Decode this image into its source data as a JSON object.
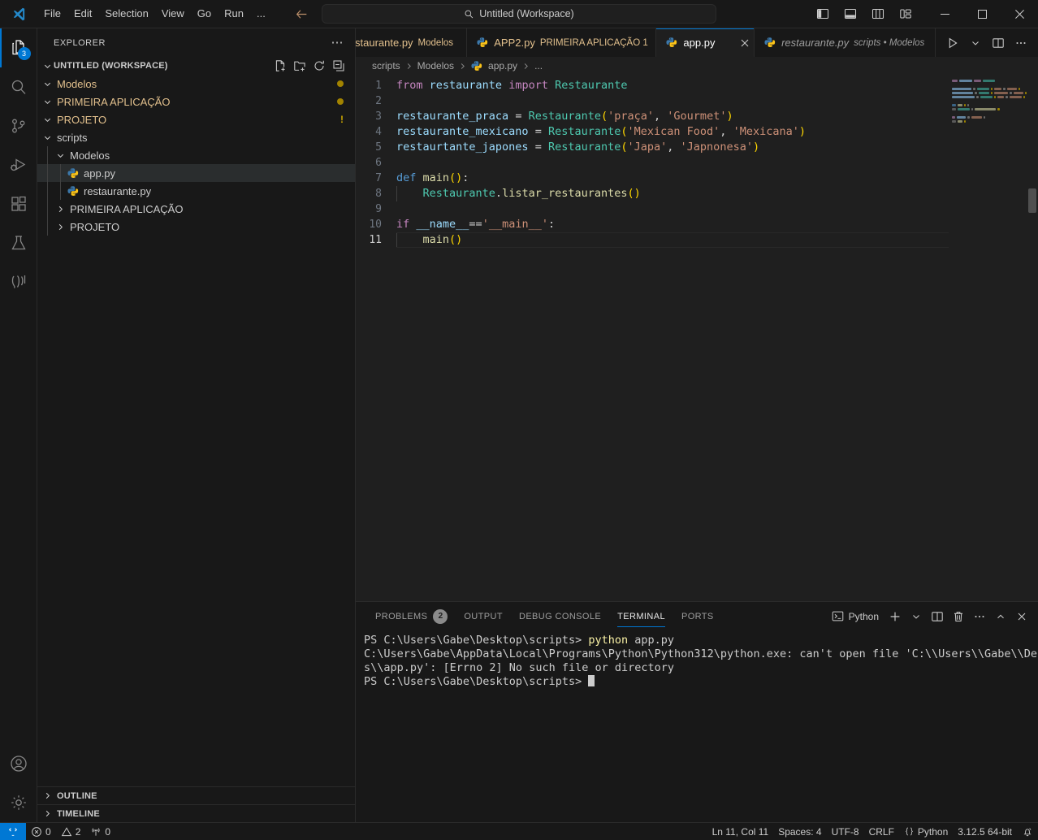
{
  "titlebar": {
    "logo_icon": "vscode-logo-icon",
    "menus": [
      "File",
      "Edit",
      "Selection",
      "View",
      "Go",
      "Run",
      "..."
    ],
    "nav_back_icon": "arrow-left-icon",
    "nav_forward_icon": "arrow-right-icon",
    "command_center": {
      "search_icon": "search-icon",
      "text": "Untitled (Workspace)"
    },
    "layout_controls": [
      {
        "name": "toggle-primary-sidebar",
        "icon": "panel-left-icon"
      },
      {
        "name": "toggle-panel",
        "icon": "panel-bottom-icon"
      },
      {
        "name": "toggle-secondary-sidebar",
        "icon": "panel-right-icon"
      },
      {
        "name": "customize-layout",
        "icon": "layout-grid-icon"
      }
    ],
    "window_controls": {
      "minimize": "—",
      "maximize": "☐",
      "close": "✕"
    }
  },
  "activitybar": {
    "items": [
      {
        "name": "explorer",
        "icon": "files-icon",
        "badge": "3",
        "active": true
      },
      {
        "name": "search",
        "icon": "search-icon",
        "badge": "",
        "active": false
      },
      {
        "name": "source-control",
        "icon": "source-control-icon",
        "badge": "",
        "active": false
      },
      {
        "name": "run-and-debug",
        "icon": "run-debug-icon",
        "badge": "",
        "active": false
      },
      {
        "name": "extensions",
        "icon": "extensions-icon",
        "badge": "",
        "active": false
      },
      {
        "name": "testing",
        "icon": "beaker-icon",
        "badge": "",
        "active": false
      },
      {
        "name": "live-share",
        "icon": "live-share-icon",
        "badge": "",
        "active": false
      }
    ],
    "bottom_items": [
      {
        "name": "accounts",
        "icon": "account-icon"
      },
      {
        "name": "manage-settings",
        "icon": "gear-icon"
      }
    ]
  },
  "sidebar": {
    "title": "EXPLORER",
    "more_actions_icon": "ellipsis-icon",
    "workspace": {
      "label": "UNTITLED (WORKSPACE)",
      "expanded": true,
      "actions": [
        {
          "name": "new-file",
          "icon": "new-file-icon"
        },
        {
          "name": "new-folder",
          "icon": "new-folder-icon"
        },
        {
          "name": "refresh-explorer",
          "icon": "refresh-icon"
        },
        {
          "name": "collapse-folders",
          "icon": "collapse-all-icon"
        }
      ]
    },
    "tree": [
      {
        "label": "Modelos",
        "type": "folder",
        "depth": 1,
        "expanded": true,
        "modified": true,
        "deco": "dot",
        "selected": false
      },
      {
        "label": "PRIMEIRA APLICAÇÃO",
        "type": "folder",
        "depth": 1,
        "expanded": true,
        "modified": true,
        "deco": "dot",
        "selected": false
      },
      {
        "label": "PROJETO",
        "type": "folder",
        "depth": 1,
        "expanded": true,
        "modified": true,
        "deco": "bang",
        "selected": false
      },
      {
        "label": "scripts",
        "type": "folder",
        "depth": 1,
        "expanded": true,
        "modified": false,
        "deco": "",
        "selected": false
      },
      {
        "label": "Modelos",
        "type": "folder",
        "depth": 2,
        "expanded": true,
        "modified": false,
        "deco": "",
        "selected": false
      },
      {
        "label": "app.py",
        "type": "python",
        "depth": 3,
        "expanded": false,
        "modified": false,
        "deco": "",
        "selected": true
      },
      {
        "label": "restaurante.py",
        "type": "python",
        "depth": 3,
        "expanded": false,
        "modified": false,
        "deco": "",
        "selected": false
      },
      {
        "label": "PRIMEIRA APLICAÇÃO",
        "type": "folder",
        "depth": 2,
        "expanded": false,
        "modified": false,
        "deco": "",
        "selected": false
      },
      {
        "label": "PROJETO",
        "type": "folder",
        "depth": 2,
        "expanded": false,
        "modified": false,
        "deco": "",
        "selected": false
      }
    ],
    "bottom_panels": [
      {
        "label": "OUTLINE",
        "expanded": false
      },
      {
        "label": "TIMELINE",
        "expanded": false
      }
    ]
  },
  "editor": {
    "tabs": [
      {
        "name": "restaurante.py",
        "label": "staurante.py",
        "description": "Modelos",
        "icon": "python-icon",
        "active": false,
        "dirty": true,
        "preview": false,
        "clipped": true
      },
      {
        "name": "APP2.py",
        "label": "APP2.py",
        "description": "PRIMEIRA APLICAÇÃO 1",
        "icon": "python-icon",
        "active": false,
        "dirty": true,
        "preview": false,
        "clipped": false
      },
      {
        "name": "app.py",
        "label": "app.py",
        "description": "",
        "icon": "python-icon",
        "active": true,
        "dirty": false,
        "preview": false,
        "clipped": false
      },
      {
        "name": "restaurante.py-preview",
        "label": "restaurante.py",
        "description": "scripts • Modelos",
        "icon": "python-icon",
        "active": false,
        "dirty": false,
        "preview": true,
        "clipped": false
      }
    ],
    "actions": [
      {
        "name": "run-python-file",
        "icon": "play-icon"
      },
      {
        "name": "run-options",
        "icon": "chevron-down-icon"
      },
      {
        "name": "split-editor",
        "icon": "split-editor-icon"
      },
      {
        "name": "more-actions",
        "icon": "ellipsis-icon"
      }
    ],
    "breadcrumbs": [
      "scripts",
      "Modelos",
      "app.py",
      "..."
    ],
    "breadcrumb_file_icon": "python-icon",
    "code_lines": [
      {
        "n": 1,
        "segments": [
          {
            "t": "from ",
            "c": "kw"
          },
          {
            "t": "restaurante ",
            "c": "var"
          },
          {
            "t": "import ",
            "c": "kw"
          },
          {
            "t": "Restaurante",
            "c": "cls"
          }
        ]
      },
      {
        "n": 2,
        "segments": []
      },
      {
        "n": 3,
        "segments": [
          {
            "t": "restaurante_praca ",
            "c": "var"
          },
          {
            "t": "= ",
            "c": "op"
          },
          {
            "t": "Restaurante",
            "c": "cls"
          },
          {
            "t": "(",
            "c": "pun"
          },
          {
            "t": "'praça'",
            "c": "str"
          },
          {
            "t": ", ",
            "c": "op"
          },
          {
            "t": "'Gourmet'",
            "c": "str"
          },
          {
            "t": ")",
            "c": "pun"
          }
        ]
      },
      {
        "n": 4,
        "segments": [
          {
            "t": "restaurante_mexicano ",
            "c": "var"
          },
          {
            "t": "= ",
            "c": "op"
          },
          {
            "t": "Restaurante",
            "c": "cls"
          },
          {
            "t": "(",
            "c": "pun"
          },
          {
            "t": "'Mexican Food'",
            "c": "str"
          },
          {
            "t": ", ",
            "c": "op"
          },
          {
            "t": "'Mexicana'",
            "c": "str"
          },
          {
            "t": ")",
            "c": "pun"
          }
        ]
      },
      {
        "n": 5,
        "segments": [
          {
            "t": "restaurtante_japones ",
            "c": "var"
          },
          {
            "t": "= ",
            "c": "op"
          },
          {
            "t": "Restaurante",
            "c": "cls"
          },
          {
            "t": "(",
            "c": "pun"
          },
          {
            "t": "'Japa'",
            "c": "str"
          },
          {
            "t": ", ",
            "c": "op"
          },
          {
            "t": "'Japnonesa'",
            "c": "str"
          },
          {
            "t": ")",
            "c": "pun"
          }
        ]
      },
      {
        "n": 6,
        "segments": []
      },
      {
        "n": 7,
        "segments": [
          {
            "t": "def ",
            "c": "kw2"
          },
          {
            "t": "main",
            "c": "fn"
          },
          {
            "t": "()",
            "c": "pun"
          },
          {
            "t": ":",
            "c": "op"
          }
        ]
      },
      {
        "n": 8,
        "segments": [
          {
            "t": "    ",
            "c": "plain"
          },
          {
            "t": "Restaurante",
            "c": "cls"
          },
          {
            "t": ".",
            "c": "op"
          },
          {
            "t": "listar_restaurantes",
            "c": "fn"
          },
          {
            "t": "()",
            "c": "pun"
          }
        ],
        "indent_guides": 1
      },
      {
        "n": 9,
        "segments": []
      },
      {
        "n": 10,
        "segments": [
          {
            "t": "if ",
            "c": "kw"
          },
          {
            "t": "__name__",
            "c": "var"
          },
          {
            "t": "==",
            "c": "op"
          },
          {
            "t": "'__main__'",
            "c": "str"
          },
          {
            "t": ":",
            "c": "op"
          }
        ]
      },
      {
        "n": 11,
        "segments": [
          {
            "t": "    ",
            "c": "plain"
          },
          {
            "t": "main",
            "c": "fn"
          },
          {
            "t": "()",
            "c": "pun"
          }
        ],
        "indent_guides": 1,
        "current": true
      }
    ]
  },
  "panel": {
    "tabs": [
      {
        "label": "PROBLEMS",
        "badge": "2",
        "active": false
      },
      {
        "label": "OUTPUT",
        "badge": "",
        "active": false
      },
      {
        "label": "DEBUG CONSOLE",
        "badge": "",
        "active": false
      },
      {
        "label": "TERMINAL",
        "badge": "",
        "active": true
      },
      {
        "label": "PORTS",
        "badge": "",
        "active": false
      }
    ],
    "terminal_selector": {
      "icon": "terminal-icon",
      "label": "Python"
    },
    "actions": [
      {
        "name": "new-terminal",
        "icon": "plus-icon"
      },
      {
        "name": "terminal-profiles",
        "icon": "chevron-down-icon"
      },
      {
        "name": "split-terminal",
        "icon": "split-icon"
      },
      {
        "name": "kill-terminal",
        "icon": "trash-icon"
      },
      {
        "name": "panel-more-actions",
        "icon": "ellipsis-icon"
      },
      {
        "name": "maximize-panel",
        "icon": "chevron-up-icon"
      },
      {
        "name": "close-panel",
        "icon": "close-icon"
      }
    ],
    "terminal_lines": [
      {
        "segments": [
          {
            "t": "PS C:\\Users\\Gabe\\Desktop\\scripts> ",
            "c": "t-path"
          },
          {
            "t": "python",
            "c": "t-cmd"
          },
          {
            "t": " app.py",
            "c": "t-arg"
          }
        ]
      },
      {
        "segments": [
          {
            "t": "C:\\Users\\Gabe\\AppData\\Local\\Programs\\Python\\Python312\\python.exe: can't open file 'C:\\\\Users\\\\Gabe\\\\Desktop\\\\script",
            "c": "t-path"
          }
        ]
      },
      {
        "segments": [
          {
            "t": "s\\\\app.py': [Errno 2] No such file or directory",
            "c": "t-path"
          }
        ]
      },
      {
        "segments": [
          {
            "t": "PS C:\\Users\\Gabe\\Desktop\\scripts> ",
            "c": "t-path"
          }
        ],
        "cursor": true
      }
    ]
  },
  "statusbar": {
    "remote_icon": "remote-window-icon",
    "left": [
      {
        "name": "problems-errors",
        "icon": "error-icon",
        "text": "0"
      },
      {
        "name": "problems-warnings",
        "icon": "warning-icon",
        "text": "2"
      },
      {
        "name": "ports-forwarded",
        "icon": "radio-tower-icon",
        "text": "0"
      }
    ],
    "right": [
      {
        "name": "editor-position",
        "text": "Ln 11, Col 11"
      },
      {
        "name": "editor-indentation",
        "text": "Spaces: 4"
      },
      {
        "name": "editor-encoding",
        "text": "UTF-8"
      },
      {
        "name": "editor-eol",
        "text": "CRLF"
      },
      {
        "name": "editor-language",
        "text": "Python",
        "icon": "braces-icon"
      },
      {
        "name": "python-interpreter",
        "text": "3.12.5 64-bit"
      },
      {
        "name": "notifications",
        "text": "",
        "icon": "bell-icon"
      }
    ]
  },
  "colors": {
    "accent": "#0078d4",
    "modified_gold": "#e2c08d",
    "warning": "#cca700",
    "editor_bg": "#1f1f1f",
    "chrome_bg": "#181818"
  }
}
